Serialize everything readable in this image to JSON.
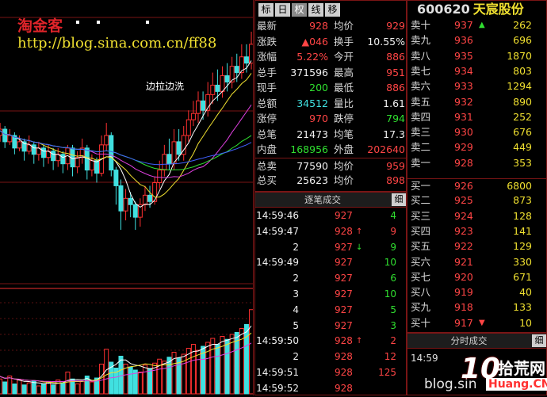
{
  "overlay": {
    "title": "淘金客",
    "url": "http://blog.sina.com.cn/ff88",
    "note": "边拉边洗"
  },
  "toolbar": {
    "tabs": [
      "标",
      "日",
      "权",
      "线",
      "移"
    ],
    "active_tab": 2,
    "up_arrow": "▲",
    "down_arrow": "▼"
  },
  "stock": {
    "code": "600620",
    "name": "天宸股份"
  },
  "quote_rows": [
    {
      "l1": "最新",
      "v1": "928",
      "c1": "red",
      "l2": "均价",
      "v2": "929",
      "c2": "red"
    },
    {
      "l1": "涨跌",
      "v1": "▲046",
      "c1": "red",
      "l2": "换手",
      "v2": "10.55%",
      "c2": "white"
    },
    {
      "l1": "涨幅",
      "v1": "5.22%",
      "c1": "red",
      "l2": "今开",
      "v2": "886",
      "c2": "red"
    },
    {
      "l1": "总手",
      "v1": "371596",
      "c1": "white",
      "l2": "最高",
      "v2": "951",
      "c2": "red"
    },
    {
      "l1": "现手",
      "v1": "200",
      "c1": "green",
      "l2": "最低",
      "v2": "886",
      "c2": "red"
    },
    {
      "l1": "总额",
      "v1": "34512",
      "c1": "cyan",
      "l2": "量比",
      "v2": "1.61",
      "c2": "white"
    },
    {
      "l1": "涨停",
      "v1": "970",
      "c1": "red",
      "l2": "跌停",
      "v2": "794",
      "c2": "green"
    },
    {
      "l1": "总笔",
      "v1": "21473",
      "c1": "white",
      "l2": "均笔",
      "v2": "17.3",
      "c2": "white"
    },
    {
      "l1": "内盘",
      "v1": "168956",
      "c1": "green",
      "l2": "外盘",
      "v2": "202640",
      "c2": "red"
    },
    {
      "l1": "总卖",
      "v1": "77590",
      "c1": "white",
      "l2": "均价",
      "v2": "959",
      "c2": "red"
    },
    {
      "l1": "总买",
      "v1": "25623",
      "c1": "white",
      "l2": "均价",
      "v2": "898",
      "c2": "red"
    }
  ],
  "sell_orders": [
    {
      "label": "卖十",
      "price": "937",
      "vol": "262",
      "mark": "up"
    },
    {
      "label": "卖九",
      "price": "936",
      "vol": "696",
      "mark": ""
    },
    {
      "label": "卖八",
      "price": "935",
      "vol": "1870",
      "mark": ""
    },
    {
      "label": "卖七",
      "price": "934",
      "vol": "803",
      "mark": ""
    },
    {
      "label": "卖六",
      "price": "933",
      "vol": "1294",
      "mark": ""
    },
    {
      "label": "卖五",
      "price": "932",
      "vol": "890",
      "mark": ""
    },
    {
      "label": "卖四",
      "price": "931",
      "vol": "252",
      "mark": ""
    },
    {
      "label": "卖三",
      "price": "930",
      "vol": "676",
      "mark": ""
    },
    {
      "label": "卖二",
      "price": "929",
      "vol": "449",
      "mark": ""
    },
    {
      "label": "卖一",
      "price": "928",
      "vol": "353",
      "mark": ""
    }
  ],
  "buy_orders": [
    {
      "label": "买一",
      "price": "926",
      "vol": "6800",
      "mark": ""
    },
    {
      "label": "买二",
      "price": "925",
      "vol": "873",
      "mark": ""
    },
    {
      "label": "买三",
      "price": "924",
      "vol": "128",
      "mark": ""
    },
    {
      "label": "买四",
      "price": "923",
      "vol": "141",
      "mark": ""
    },
    {
      "label": "买五",
      "price": "922",
      "vol": "129",
      "mark": ""
    },
    {
      "label": "买六",
      "price": "921",
      "vol": "330",
      "mark": ""
    },
    {
      "label": "买七",
      "price": "920",
      "vol": "671",
      "mark": ""
    },
    {
      "label": "买八",
      "price": "919",
      "vol": "40",
      "mark": ""
    },
    {
      "label": "买九",
      "price": "918",
      "vol": "133",
      "mark": ""
    },
    {
      "label": "买十",
      "price": "917",
      "vol": "10",
      "mark": "down"
    }
  ],
  "trades": {
    "header": "逐笔成交",
    "detail_button": "细",
    "rows": [
      {
        "time": "14:59:46",
        "price": "927",
        "dir": "",
        "vol": "4",
        "vcolor": "green"
      },
      {
        "time": "14:59:47",
        "price": "928",
        "dir": "up",
        "vol": "9",
        "vcolor": "red"
      },
      {
        "time": "2",
        "price": "927",
        "dir": "down",
        "vol": "9",
        "vcolor": "green"
      },
      {
        "time": "14:59:49",
        "price": "927",
        "dir": "",
        "vol": "10",
        "vcolor": "green"
      },
      {
        "time": "2",
        "price": "927",
        "dir": "",
        "vol": "6",
        "vcolor": "green"
      },
      {
        "time": "3",
        "price": "927",
        "dir": "",
        "vol": "10",
        "vcolor": "green"
      },
      {
        "time": "4",
        "price": "927",
        "dir": "",
        "vol": "5",
        "vcolor": "green"
      },
      {
        "time": "5",
        "price": "927",
        "dir": "",
        "vol": "3",
        "vcolor": "green"
      },
      {
        "time": "14:59:50",
        "price": "928",
        "dir": "up",
        "vol": "2",
        "vcolor": "red"
      },
      {
        "time": "2",
        "price": "928",
        "dir": "",
        "vol": "12",
        "vcolor": "red"
      },
      {
        "time": "14:59:51",
        "price": "928",
        "dir": "",
        "vol": "125",
        "vcolor": "red"
      },
      {
        "time": "14:59:52",
        "price": "928",
        "dir": "",
        "vol": "",
        "vcolor": "red"
      }
    ]
  },
  "timeshare": {
    "header": "分时成交",
    "detail_button": "细",
    "row_time": "14:59"
  },
  "watermark": {
    "blog_text": "blog.sin",
    "brand_num": "10",
    "brand_cn": "拾荒网",
    "brand_url": "Huang.CN"
  },
  "chart_data": {
    "type": "candlestick",
    "grid": "horizontal",
    "price_colors": {
      "up": "#ff3030",
      "down": "#40e0e0"
    },
    "ma_colors": [
      "#ffffff",
      "#f0e030",
      "#e040e0",
      "#30e030",
      "#4060ff"
    ],
    "candles": [
      [
        0.7,
        0.67,
        0.71,
        0.65
      ],
      [
        0.66,
        0.68,
        0.7,
        0.64
      ],
      [
        0.68,
        0.64,
        0.69,
        0.62
      ],
      [
        0.64,
        0.66,
        0.68,
        0.63
      ],
      [
        0.66,
        0.62,
        0.67,
        0.6
      ],
      [
        0.62,
        0.64,
        0.66,
        0.61
      ],
      [
        0.64,
        0.61,
        0.65,
        0.58
      ],
      [
        0.61,
        0.63,
        0.66,
        0.6
      ],
      [
        0.63,
        0.6,
        0.64,
        0.57
      ],
      [
        0.6,
        0.62,
        0.64,
        0.58
      ],
      [
        0.62,
        0.59,
        0.63,
        0.56
      ],
      [
        0.59,
        0.61,
        0.63,
        0.57
      ],
      [
        0.61,
        0.58,
        0.62,
        0.55
      ],
      [
        0.58,
        0.6,
        0.62,
        0.56
      ],
      [
        0.6,
        0.57,
        0.61,
        0.54
      ],
      [
        0.57,
        0.62,
        0.63,
        0.55
      ],
      [
        0.62,
        0.56,
        0.63,
        0.53
      ],
      [
        0.56,
        0.59,
        0.61,
        0.54
      ],
      [
        0.59,
        0.62,
        0.65,
        0.57
      ],
      [
        0.62,
        0.55,
        0.63,
        0.52
      ],
      [
        0.55,
        0.58,
        0.6,
        0.53
      ],
      [
        0.58,
        0.54,
        0.59,
        0.51
      ],
      [
        0.54,
        0.63,
        0.66,
        0.53
      ],
      [
        0.63,
        0.66,
        0.7,
        0.61
      ],
      [
        0.66,
        0.55,
        0.67,
        0.53
      ],
      [
        0.55,
        0.5,
        0.56,
        0.44
      ],
      [
        0.5,
        0.42,
        0.52,
        0.36
      ],
      [
        0.42,
        0.46,
        0.49,
        0.39
      ],
      [
        0.46,
        0.44,
        0.48,
        0.4
      ],
      [
        0.44,
        0.4,
        0.45,
        0.36
      ],
      [
        0.4,
        0.44,
        0.46,
        0.37
      ],
      [
        0.44,
        0.47,
        0.5,
        0.42
      ],
      [
        0.47,
        0.45,
        0.5,
        0.43
      ],
      [
        0.45,
        0.51,
        0.53,
        0.44
      ],
      [
        0.51,
        0.55,
        0.58,
        0.49
      ],
      [
        0.55,
        0.6,
        0.63,
        0.53
      ],
      [
        0.6,
        0.57,
        0.65,
        0.55
      ],
      [
        0.57,
        0.64,
        0.68,
        0.55
      ],
      [
        0.64,
        0.6,
        0.68,
        0.58
      ],
      [
        0.6,
        0.66,
        0.69,
        0.58
      ],
      [
        0.66,
        0.71,
        0.74,
        0.64
      ],
      [
        0.71,
        0.73,
        0.77,
        0.69
      ],
      [
        0.73,
        0.77,
        0.8,
        0.7
      ],
      [
        0.77,
        0.74,
        0.8,
        0.71
      ],
      [
        0.74,
        0.79,
        0.83,
        0.72
      ],
      [
        0.79,
        0.82,
        0.86,
        0.76
      ],
      [
        0.82,
        0.8,
        0.87,
        0.77
      ],
      [
        0.8,
        0.85,
        0.88,
        0.78
      ],
      [
        0.85,
        0.83,
        0.89,
        0.8
      ],
      [
        0.83,
        0.88,
        0.91,
        0.81
      ],
      [
        0.88,
        0.86,
        0.92,
        0.83
      ],
      [
        0.86,
        0.91,
        0.95,
        0.84
      ],
      [
        0.91,
        0.89,
        0.95,
        0.86
      ],
      [
        0.89,
        0.95,
        0.99,
        0.87
      ]
    ],
    "volumes": [
      0.2,
      0.15,
      0.12,
      0.18,
      0.1,
      0.14,
      0.09,
      0.11,
      0.13,
      0.08,
      0.1,
      0.12,
      0.09,
      0.14,
      0.11,
      0.22,
      0.15,
      0.1,
      0.13,
      0.18,
      0.12,
      0.16,
      0.3,
      0.45,
      0.32,
      0.26,
      0.38,
      0.3,
      0.27,
      0.24,
      0.22,
      0.29,
      0.25,
      0.31,
      0.35,
      0.33,
      0.37,
      0.42,
      0.36,
      0.4,
      0.46,
      0.5,
      0.44,
      0.48,
      0.52,
      0.56,
      0.5,
      0.58,
      0.55,
      0.6,
      0.62,
      0.66,
      0.7,
      0.85
    ]
  }
}
